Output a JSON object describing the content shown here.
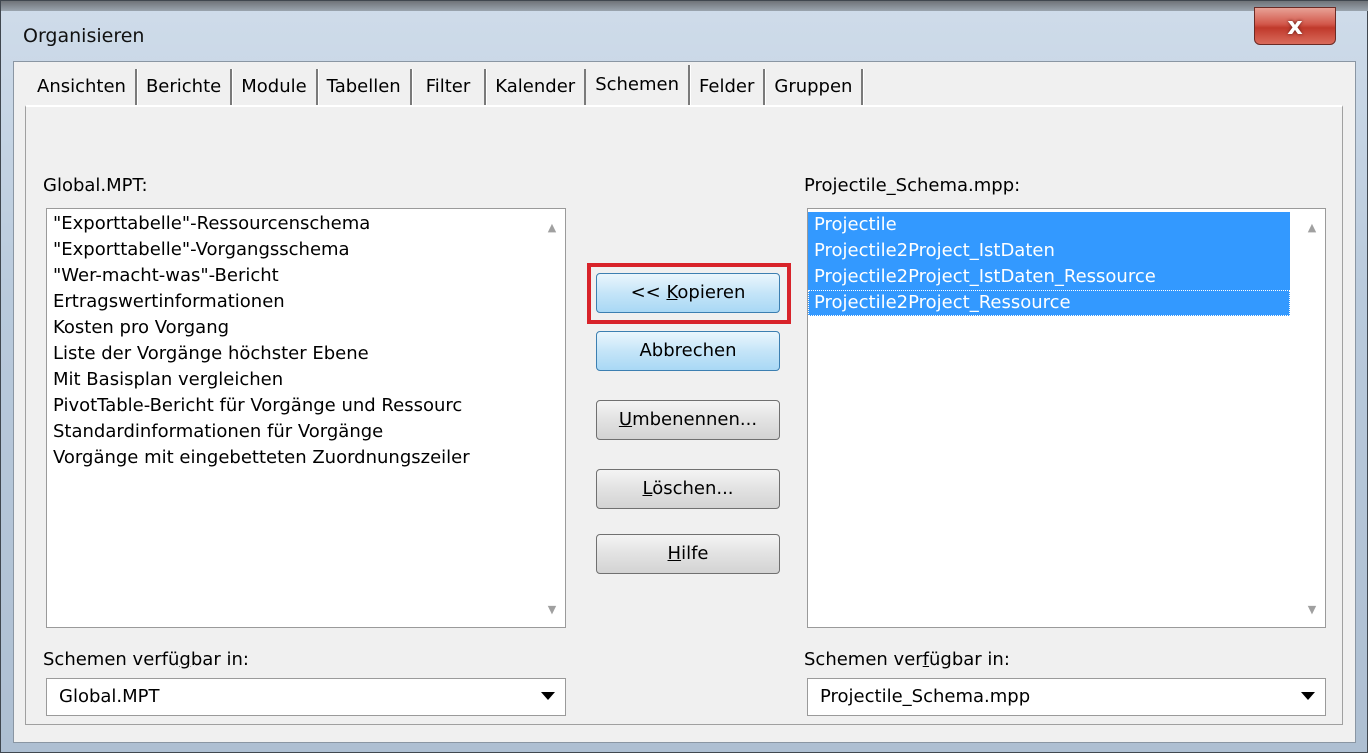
{
  "window": {
    "title": "Organisieren",
    "close_label": "x"
  },
  "tabs": [
    {
      "label": "Ansichten"
    },
    {
      "label": "Berichte"
    },
    {
      "label": "Module"
    },
    {
      "label": "Tabellen"
    },
    {
      "label": "Filter"
    },
    {
      "label": "Kalender"
    },
    {
      "label": "Schemen",
      "active": true
    },
    {
      "label": "Felder"
    },
    {
      "label": "Gruppen"
    }
  ],
  "left": {
    "header": "Global.MPT:",
    "items": [
      "\"Exporttabelle\"-Ressourcenschema",
      "\"Exporttabelle\"-Vorgangsschema",
      "\"Wer-macht-was\"-Bericht",
      "Ertragswertinformationen",
      "Kosten pro Vorgang",
      "Liste der Vorgänge höchster Ebene",
      "Mit Basisplan vergleichen",
      "PivotTable-Bericht für Vorgänge und Ressourc",
      "Standardinformationen für Vorgänge",
      "Vorgänge mit eingebetteten Zuordnungszeiler"
    ],
    "available_label": "Schemen verfügbar in:",
    "available_value": "Global.MPT"
  },
  "right": {
    "header": "Projectile_Schema.mpp:",
    "items": [
      "Projectile",
      "Projectile2Project_IstDaten",
      "Projectile2Project_IstDaten_Ressource",
      "Projectile2Project_Ressource"
    ],
    "available_label": "Schemen verfügbar in:",
    "available_value": "Projectile_Schema.mpp"
  },
  "buttons": {
    "copy": "<< Kopieren",
    "cancel": "Abbrechen",
    "rename": "Umbenennen...",
    "delete": "Löschen...",
    "help": "Hilfe"
  }
}
